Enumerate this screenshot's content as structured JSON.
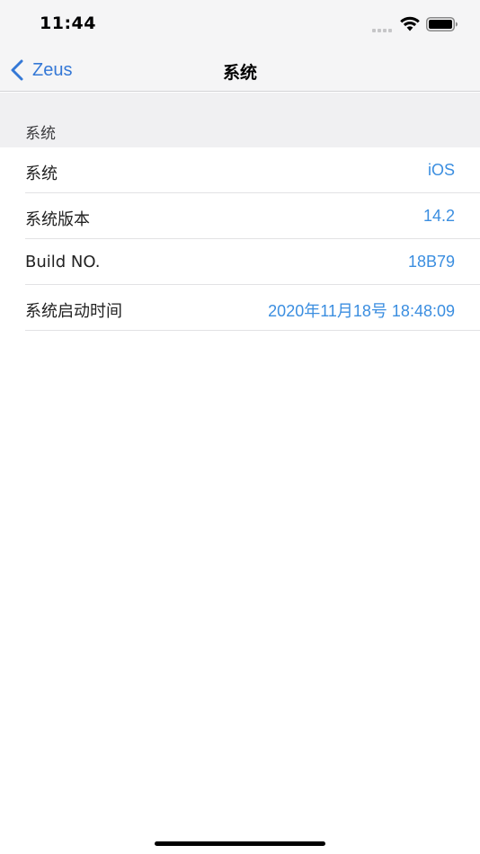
{
  "status_bar": {
    "time": "11:44",
    "icons": [
      "signal-icon",
      "wifi-icon",
      "battery-icon"
    ]
  },
  "nav": {
    "back_label": "Zeus",
    "title": "系统"
  },
  "section": {
    "header": "系统"
  },
  "rows": [
    {
      "label": "系统",
      "value": "iOS"
    },
    {
      "label": "系统版本",
      "value": "14.2"
    },
    {
      "label": "Build NO.",
      "value": "18B79"
    },
    {
      "label": "系统启动时间",
      "value": "2020年11月18号 18:48:09"
    }
  ],
  "colors": {
    "accent": "#3478d6",
    "value_text": "#3b8ee0",
    "bar_background": "#f5f5f6",
    "section_background": "#f0f0f2"
  }
}
